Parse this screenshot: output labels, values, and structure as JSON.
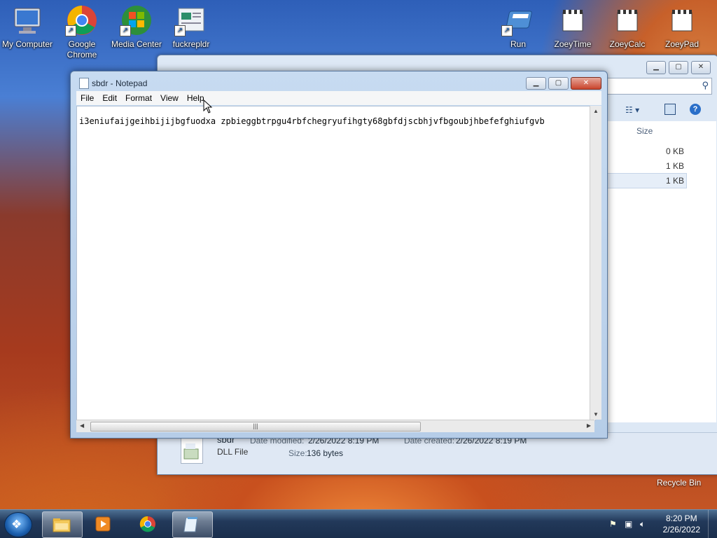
{
  "desktop": {
    "icons": [
      {
        "label": "My Computer",
        "icon": "computer-icon"
      },
      {
        "label": "Google Chrome",
        "icon": "chrome-icon"
      },
      {
        "label": "Media Center",
        "icon": "windows-media-center-icon"
      },
      {
        "label": "fuckrepldr",
        "icon": "shortcut-app-icon"
      },
      {
        "label": "Run",
        "icon": "run-icon"
      },
      {
        "label": "ZoeyTime",
        "icon": "clapper-icon"
      },
      {
        "label": "ZoeyCalc",
        "icon": "clapper-icon"
      },
      {
        "label": "ZoeyPad",
        "icon": "clapper-icon"
      }
    ],
    "recycle_bin": "Recycle Bin"
  },
  "explorer": {
    "column_size": "Size",
    "sizes": [
      "0 KB",
      "1 KB",
      "1 KB"
    ],
    "details": {
      "name": "sbdr",
      "type": "DLL File",
      "date_modified_label": "Date modified:",
      "date_modified": "2/26/2022 8:19 PM",
      "date_created_label": "Date created:",
      "date_created": "2/26/2022 8:19 PM",
      "size_label": "Size:",
      "size": "136 bytes"
    }
  },
  "notepad": {
    "title": "sbdr - Notepad",
    "menu": [
      "File",
      "Edit",
      "Format",
      "View",
      "Help"
    ],
    "content": "i3eniufaijgeihbijijbgfuodxa zpbieggbtrpgu4rbfchegryufihgty68gbfdjscbhjvfbgoubjhbefefghiufgvb"
  },
  "taskbar": {
    "time": "8:20 PM",
    "date": "2/26/2022"
  }
}
